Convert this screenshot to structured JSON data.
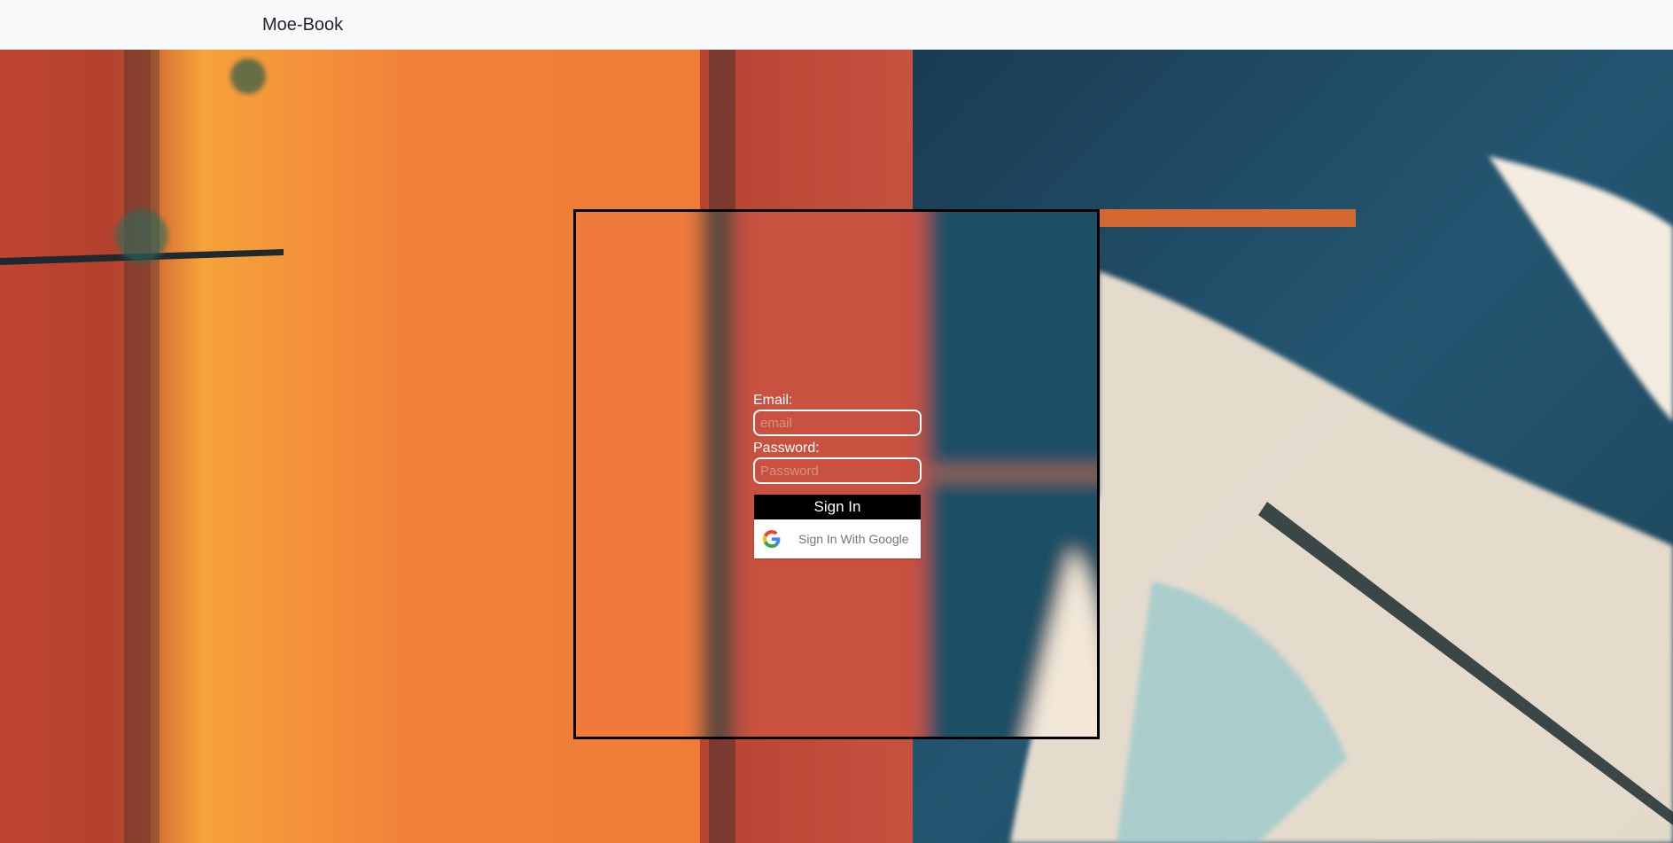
{
  "navbar": {
    "brand": "Moe-Book"
  },
  "login": {
    "email_label": "Email:",
    "email_placeholder": "email",
    "email_value": "",
    "password_label": "Password:",
    "password_placeholder": "Password",
    "password_value": "",
    "signin_label": "Sign In",
    "google_label": "Sign In With Google"
  },
  "background": {
    "description_colors": [
      "#f07a3a",
      "#c9513f",
      "#1f4f66",
      "#f1e6d6"
    ]
  },
  "icons": {
    "google": "google-g-icon"
  }
}
